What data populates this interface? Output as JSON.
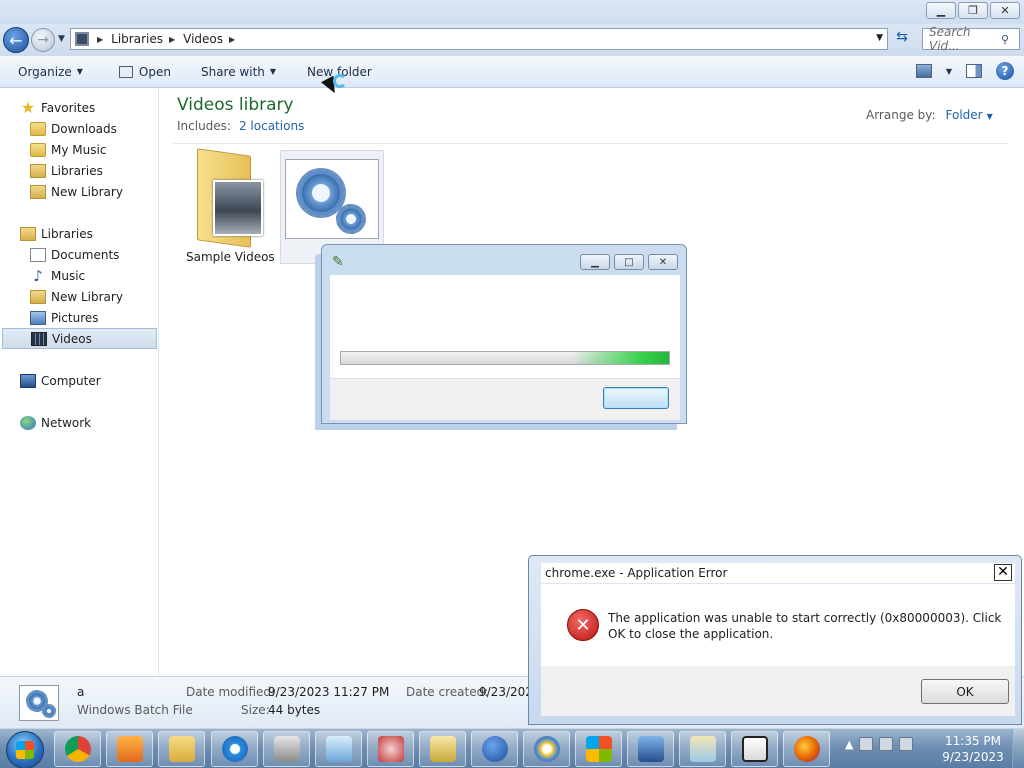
{
  "explorer": {
    "breadcrumb": [
      "Libraries",
      "Videos"
    ],
    "search_placeholder": "Search Vid...",
    "toolbar": {
      "organize": "Organize",
      "open": "Open",
      "share_with": "Share with",
      "new_folder": "New folder"
    },
    "nav": {
      "favorites": "Favorites",
      "downloads": "Downloads",
      "my_music": "My Music",
      "fav_libraries": "Libraries",
      "fav_new_library": "New Library",
      "libraries": "Libraries",
      "documents": "Documents",
      "music": "Music",
      "new_library": "New Library",
      "pictures": "Pictures",
      "videos": "Videos",
      "computer": "Computer",
      "network": "Network"
    },
    "library": {
      "title": "Videos library",
      "includes_label": "Includes:",
      "includes_link": "2 locations",
      "arrange_label": "Arrange by:",
      "arrange_value": "Folder"
    },
    "items": {
      "sample_videos": "Sample Videos"
    },
    "details": {
      "name": "a",
      "type": "Windows Batch File",
      "modified_label": "Date modified:",
      "modified_value": "9/23/2023 11:27 PM",
      "created_label": "Date created:",
      "created_value": "9/23/202",
      "size_label": "Size:",
      "size_value": "44 bytes"
    }
  },
  "progress_dialog": {
    "progress_fraction": 0.3
  },
  "error_dialog": {
    "title": "chrome.exe - Application Error",
    "close_glyph": "✕",
    "message": "The application was unable to start correctly (0x80000003). Click OK to close the application.",
    "ok_label": "OK"
  },
  "taskbar": {
    "apps": [
      "chrome",
      "media-player",
      "explorer",
      "internet-explorer",
      "scanner",
      "notepad",
      "snipping-tool",
      "calculator",
      "help",
      "paint",
      "windows-update",
      "remote-desktop",
      "file-manager",
      "7zip",
      "firefox"
    ],
    "time": "11:35 PM",
    "date": "9/23/2023"
  },
  "colors": {
    "library_title": "#1d6a2e",
    "link": "#1e62b0",
    "error_red": "#b8150f",
    "progress_green": "#3cd250"
  }
}
